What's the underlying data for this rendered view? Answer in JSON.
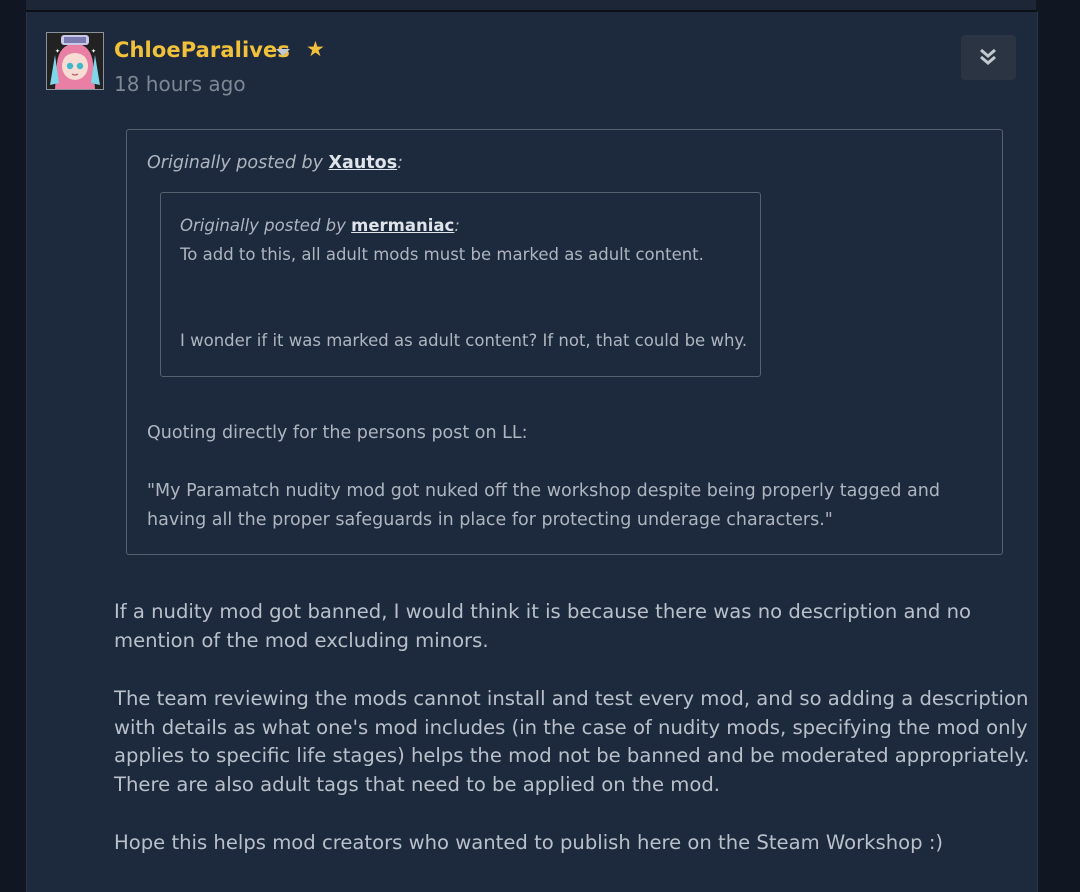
{
  "post": {
    "author": "ChloeParalives",
    "timestamp": "18 hours ago",
    "star": "★",
    "quote_outer": {
      "prefix": "Originally posted by",
      "author": "Xautos",
      "suffix": ":",
      "lines": [
        "Quoting directly for the persons post on LL:",
        "\"My Paramatch nudity mod got nuked off the workshop despite being properly tagged and",
        "having all the proper safeguards in place for protecting underage characters.\""
      ]
    },
    "quote_inner": {
      "prefix": "Originally posted by",
      "author": "mermaniac",
      "suffix": ":",
      "lines": [
        "To add to this, all adult mods must be marked as adult content.",
        "I wonder if it was marked as adult content? If not, that could be why."
      ]
    },
    "body": [
      "If a nudity mod got banned, I would think it is because there was no description and no",
      "mention of the mod excluding minors.",
      "The team reviewing the mods cannot install and test every mod, and so adding a description",
      "with details as what one's mod includes (in the case of nudity mods, specifying the mod only",
      "applies to specific life stages) helps the mod not be banned and be moderated appropriately.",
      "There are also adult tags that need to be applied on the mod.",
      "Hope this helps mod creators who wanted to publish here on the Steam Workshop :)"
    ]
  },
  "icons": {
    "avatar": "avatar",
    "dropdown": "chevron-down-icon",
    "expand": "double-chevron-down-icon"
  },
  "colors": {
    "background": "#1d2a3d",
    "username": "#f2c13b",
    "text": "#b9c0c9",
    "timestamp": "#7d8894"
  }
}
